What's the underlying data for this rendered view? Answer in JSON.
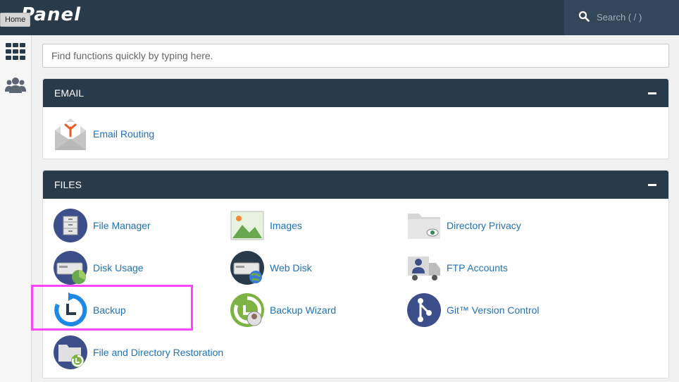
{
  "header": {
    "logo_text": "Panel",
    "home_tooltip": "Home",
    "search_placeholder": "Search ( / )"
  },
  "sidebar": {
    "items": [
      {
        "icon": "grid-icon"
      },
      {
        "icon": "users-icon"
      }
    ]
  },
  "find": {
    "placeholder": "Find functions quickly by typing here."
  },
  "sections": {
    "email": {
      "title": "EMAIL",
      "items": [
        {
          "label": "Email Routing",
          "icon": "email-routing-icon"
        }
      ]
    },
    "files": {
      "title": "FILES",
      "items": [
        {
          "label": "File Manager",
          "icon": "file-manager-icon"
        },
        {
          "label": "Images",
          "icon": "images-icon"
        },
        {
          "label": "Directory Privacy",
          "icon": "directory-privacy-icon"
        },
        {
          "label": "Disk Usage",
          "icon": "disk-usage-icon"
        },
        {
          "label": "Web Disk",
          "icon": "web-disk-icon"
        },
        {
          "label": "FTP Accounts",
          "icon": "ftp-accounts-icon"
        },
        {
          "label": "Backup",
          "icon": "backup-icon"
        },
        {
          "label": "Backup Wizard",
          "icon": "backup-wizard-icon"
        },
        {
          "label": "Git™ Version Control",
          "icon": "git-icon"
        },
        {
          "label": "File and Directory Restoration",
          "icon": "file-restoration-icon"
        }
      ]
    }
  },
  "colors": {
    "header_bg": "#293a4a",
    "link": "#1f72b8",
    "highlight": "#ff44ff"
  }
}
